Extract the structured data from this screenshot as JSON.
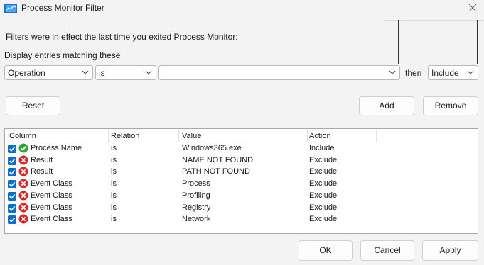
{
  "window": {
    "title": "Process Monitor Filter",
    "close_icon": "close-icon"
  },
  "messages": {
    "filters_note": "Filters were in effect the last time you exited Process Monitor:",
    "display_matching": "Display entries matching these"
  },
  "criteria": {
    "column": "Operation",
    "relation": "is",
    "value": "",
    "then_label": "then",
    "action": "Include"
  },
  "buttons": {
    "reset": "Reset",
    "add": "Add",
    "remove": "Remove",
    "ok": "OK",
    "cancel": "Cancel",
    "apply": "Apply"
  },
  "table": {
    "headers": [
      "Column",
      "Relation",
      "Value",
      "Action"
    ],
    "rows": [
      {
        "checked": true,
        "status": "include",
        "column": "Process Name",
        "relation": "is",
        "value": "Windows365.exe",
        "action": "Include"
      },
      {
        "checked": true,
        "status": "exclude",
        "column": "Result",
        "relation": "is",
        "value": "NAME NOT FOUND",
        "action": "Exclude"
      },
      {
        "checked": true,
        "status": "exclude",
        "column": "Result",
        "relation": "is",
        "value": "PATH NOT FOUND",
        "action": "Exclude"
      },
      {
        "checked": true,
        "status": "exclude",
        "column": "Event Class",
        "relation": "is",
        "value": "Process",
        "action": "Exclude"
      },
      {
        "checked": true,
        "status": "exclude",
        "column": "Event Class",
        "relation": "is",
        "value": "Profiling",
        "action": "Exclude"
      },
      {
        "checked": true,
        "status": "exclude",
        "column": "Event Class",
        "relation": "is",
        "value": "Registry",
        "action": "Exclude"
      },
      {
        "checked": true,
        "status": "exclude",
        "column": "Event Class",
        "relation": "is",
        "value": "Network",
        "action": "Exclude"
      }
    ]
  },
  "colors": {
    "include": "#2ea43a",
    "exclude": "#d42a2a",
    "checkbox": "#0b6fc9"
  }
}
